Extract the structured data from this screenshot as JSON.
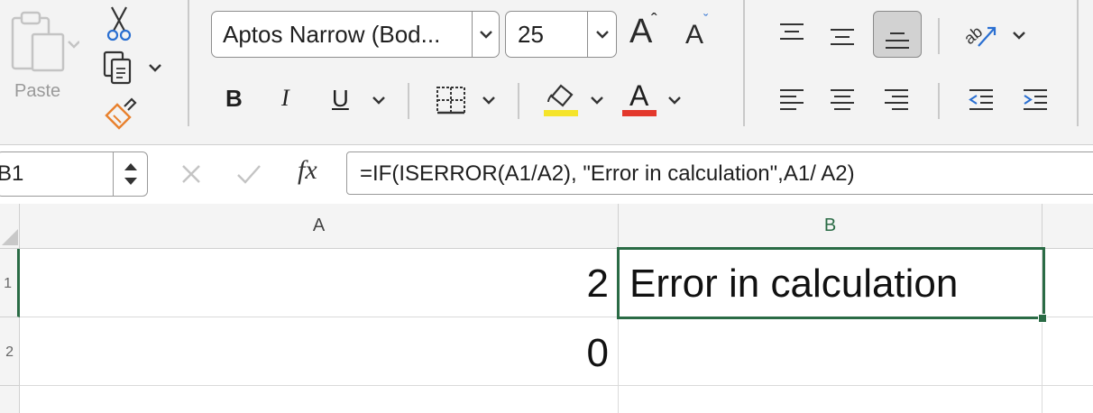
{
  "ribbon": {
    "clipboard": {
      "paste_label": "Paste"
    },
    "font": {
      "font_name": "Aptos Narrow (Bod...",
      "font_size": "25",
      "grow_letter": "A",
      "grow_caret": "ˆ",
      "shrink_letter": "A",
      "shrink_caret": "ˇ",
      "bold": "B",
      "italic": "I",
      "underline": "U",
      "font_color_letter": "A",
      "highlight_color": "#f5e42a",
      "font_color": "#e3382c"
    }
  },
  "formula_bar": {
    "name_box": "B1",
    "fx_label": "fx",
    "formula": "=IF(ISERROR(A1/A2), \"Error in calculation\",A1/ A2)"
  },
  "grid": {
    "columns": [
      "A",
      "B"
    ],
    "rows": [
      {
        "header": "1",
        "A": "2",
        "B": "Error in calculation"
      },
      {
        "header": "2",
        "A": "0",
        "B": ""
      }
    ],
    "selection_color": "#2a6b45"
  }
}
